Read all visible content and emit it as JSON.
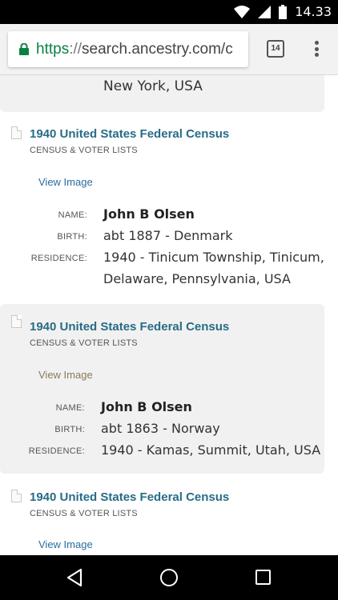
{
  "status": {
    "time": "14.33"
  },
  "browser": {
    "url_scheme": "https",
    "url_separator": "://",
    "url_host": "search.ancestry.com/c",
    "tab_count": "14"
  },
  "top_card": {
    "text": "New York, USA"
  },
  "labels": {
    "name": "NAME:",
    "birth": "BIRTH:",
    "residence": "RESIDENCE:"
  },
  "records": [
    {
      "title": "1940 United States Federal Census",
      "category": "CENSUS & VOTER LISTS",
      "view_image": "View Image",
      "name": "John B Olsen",
      "birth": "abt 1887 - Denmark",
      "residence_line1": "1940 - Tinicum Township, Tinicum,",
      "residence_line2": "Delaware, Pennsylvania, USA"
    },
    {
      "title": "1940 United States Federal Census",
      "category": "CENSUS & VOTER LISTS",
      "view_image": "View Image",
      "name": "John B Olsen",
      "birth": "abt 1863 - Norway",
      "residence_line1": "1940 - Kamas, Summit, Utah, USA"
    },
    {
      "title": "1940 United States Federal Census",
      "category": "CENSUS & VOTER LISTS",
      "view_image": "View Image"
    }
  ],
  "colors": {
    "link": "#276c86",
    "secure": "#0b8043",
    "shaded": "#f1f1f1"
  },
  "icons": [
    "wifi-icon",
    "signal-icon",
    "battery-icon",
    "lock-icon",
    "tab-switcher-icon",
    "overflow-menu-icon",
    "document-icon",
    "back-icon",
    "home-icon",
    "recents-icon"
  ]
}
